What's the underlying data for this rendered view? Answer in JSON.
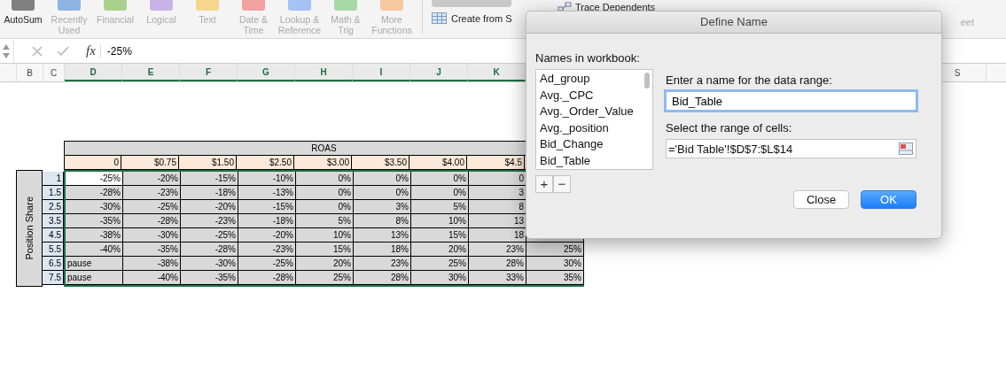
{
  "ribbon": {
    "buttons": [
      {
        "label": "AutoSum",
        "disabled": false,
        "color": "#808080"
      },
      {
        "label": "Recently Used",
        "disabled": true,
        "color": "#8fb4e3"
      },
      {
        "label": "Financial",
        "disabled": true,
        "color": "#a9d18e"
      },
      {
        "label": "Logical",
        "disabled": true,
        "color": "#c9b3e6"
      },
      {
        "label": "Text",
        "disabled": true,
        "color": "#f6d58c"
      },
      {
        "label": "Date & Time",
        "disabled": true,
        "color": "#f2a0a0"
      },
      {
        "label": "Lookup & Reference",
        "disabled": true,
        "color": "#a4c2f4"
      },
      {
        "label": "Math & Trig",
        "disabled": true,
        "color": "#a8d8a8"
      },
      {
        "label": "More Functions",
        "disabled": true,
        "color": "#f8c8a0"
      }
    ],
    "create_from_selection": "Create from S",
    "trace_dependents": "Trace Dependents",
    "cut_label": "eet"
  },
  "formula_bar": {
    "fx": "fx",
    "value": "-25%"
  },
  "column_headers": [
    {
      "label": "B",
      "selected": false
    },
    {
      "label": "C",
      "selected": false
    },
    {
      "label": "D",
      "selected": true
    },
    {
      "label": "E",
      "selected": true
    },
    {
      "label": "F",
      "selected": true
    },
    {
      "label": "G",
      "selected": true
    },
    {
      "label": "H",
      "selected": true
    },
    {
      "label": "I",
      "selected": true
    },
    {
      "label": "J",
      "selected": true
    },
    {
      "label": "K",
      "selected": true
    }
  ],
  "far_column_header": {
    "label": "S",
    "selected": false
  },
  "table": {
    "group_header": "ROAS",
    "row_group_label": "Position Share",
    "columns": [
      "0",
      "$0.75",
      "$1.50",
      "$2.50",
      "$3.00",
      "$3.50",
      "$4.00",
      "$4.5",
      null
    ],
    "rows": [
      {
        "label": "1",
        "cells": [
          {
            "text": "-25%",
            "kind": "number",
            "active": true
          },
          {
            "text": "-20%",
            "kind": "number",
            "active": false
          },
          {
            "text": "-15%",
            "kind": "number",
            "active": false
          },
          {
            "text": "-10%",
            "kind": "number",
            "active": false
          },
          {
            "text": "0%",
            "kind": "number",
            "active": false
          },
          {
            "text": "0%",
            "kind": "number",
            "active": false
          },
          {
            "text": "0%",
            "kind": "number",
            "active": false
          },
          {
            "text": "0",
            "kind": "number",
            "active": false
          },
          null
        ]
      },
      {
        "label": "1.5",
        "cells": [
          {
            "text": "-28%",
            "kind": "number",
            "active": false
          },
          {
            "text": "-23%",
            "kind": "number",
            "active": false
          },
          {
            "text": "-18%",
            "kind": "number",
            "active": false
          },
          {
            "text": "-13%",
            "kind": "number",
            "active": false
          },
          {
            "text": "0%",
            "kind": "number",
            "active": false
          },
          {
            "text": "0%",
            "kind": "number",
            "active": false
          },
          {
            "text": "0%",
            "kind": "number",
            "active": false
          },
          {
            "text": "3",
            "kind": "number",
            "active": false
          },
          null
        ]
      },
      {
        "label": "2.5",
        "cells": [
          {
            "text": "-30%",
            "kind": "number",
            "active": false
          },
          {
            "text": "-25%",
            "kind": "number",
            "active": false
          },
          {
            "text": "-20%",
            "kind": "number",
            "active": false
          },
          {
            "text": "-15%",
            "kind": "number",
            "active": false
          },
          {
            "text": "0%",
            "kind": "number",
            "active": false
          },
          {
            "text": "3%",
            "kind": "number",
            "active": false
          },
          {
            "text": "5%",
            "kind": "number",
            "active": false
          },
          {
            "text": "8",
            "kind": "number",
            "active": false
          },
          null
        ]
      },
      {
        "label": "3.5",
        "cells": [
          {
            "text": "-35%",
            "kind": "number",
            "active": false
          },
          {
            "text": "-28%",
            "kind": "number",
            "active": false
          },
          {
            "text": "-23%",
            "kind": "number",
            "active": false
          },
          {
            "text": "-18%",
            "kind": "number",
            "active": false
          },
          {
            "text": "5%",
            "kind": "number",
            "active": false
          },
          {
            "text": "8%",
            "kind": "number",
            "active": false
          },
          {
            "text": "10%",
            "kind": "number",
            "active": false
          },
          {
            "text": "13",
            "kind": "number",
            "active": false
          },
          null
        ]
      },
      {
        "label": "4.5",
        "cells": [
          {
            "text": "-38%",
            "kind": "number",
            "active": false
          },
          {
            "text": "-30%",
            "kind": "number",
            "active": false
          },
          {
            "text": "-25%",
            "kind": "number",
            "active": false
          },
          {
            "text": "-20%",
            "kind": "number",
            "active": false
          },
          {
            "text": "10%",
            "kind": "number",
            "active": false
          },
          {
            "text": "13%",
            "kind": "number",
            "active": false
          },
          {
            "text": "15%",
            "kind": "number",
            "active": false
          },
          {
            "text": "18",
            "kind": "number",
            "active": false
          },
          null
        ]
      },
      {
        "label": "5.5",
        "cells": [
          {
            "text": "-40%",
            "kind": "number",
            "active": false
          },
          {
            "text": "-35%",
            "kind": "number",
            "active": false
          },
          {
            "text": "-28%",
            "kind": "number",
            "active": false
          },
          {
            "text": "-23%",
            "kind": "number",
            "active": false
          },
          {
            "text": "15%",
            "kind": "number",
            "active": false
          },
          {
            "text": "18%",
            "kind": "number",
            "active": false
          },
          {
            "text": "20%",
            "kind": "number",
            "active": false
          },
          {
            "text": "23%",
            "kind": "number",
            "active": false
          },
          {
            "text": "25%",
            "kind": "number",
            "active": false
          }
        ]
      },
      {
        "label": "6.5",
        "cells": [
          {
            "text": "pause",
            "kind": "text",
            "active": false
          },
          {
            "text": "-38%",
            "kind": "number",
            "active": false
          },
          {
            "text": "-30%",
            "kind": "number",
            "active": false
          },
          {
            "text": "-25%",
            "kind": "number",
            "active": false
          },
          {
            "text": "20%",
            "kind": "number",
            "active": false
          },
          {
            "text": "23%",
            "kind": "number",
            "active": false
          },
          {
            "text": "25%",
            "kind": "number",
            "active": false
          },
          {
            "text": "28%",
            "kind": "number",
            "active": false
          },
          {
            "text": "30%",
            "kind": "number",
            "active": false
          }
        ]
      },
      {
        "label": "7.5",
        "cells": [
          {
            "text": "pause",
            "kind": "text",
            "active": false
          },
          {
            "text": "-40%",
            "kind": "number",
            "active": false
          },
          {
            "text": "-35%",
            "kind": "number",
            "active": false
          },
          {
            "text": "-28%",
            "kind": "number",
            "active": false
          },
          {
            "text": "25%",
            "kind": "number",
            "active": false
          },
          {
            "text": "28%",
            "kind": "number",
            "active": false
          },
          {
            "text": "30%",
            "kind": "number",
            "active": false
          },
          {
            "text": "33%",
            "kind": "number",
            "active": false
          },
          {
            "text": "35%",
            "kind": "number",
            "active": false
          }
        ]
      }
    ]
  },
  "dialog": {
    "title": "Define Name",
    "names_label": "Names in workbook:",
    "names": [
      "Ad_group",
      "Avg._CPC",
      "Avg._Order_Value",
      "Avg._position",
      "Bid_Change",
      "Bid_Table"
    ],
    "add_button": "+",
    "remove_button": "−",
    "name_label": "Enter a name for the data range:",
    "name_value": "Bid_Table",
    "range_label": "Select the range of cells:",
    "range_value": "='Bid Table'!$D$7:$L$14",
    "buttons": [
      {
        "label": "Close",
        "default": false
      },
      {
        "label": "OK",
        "default": true
      }
    ]
  }
}
